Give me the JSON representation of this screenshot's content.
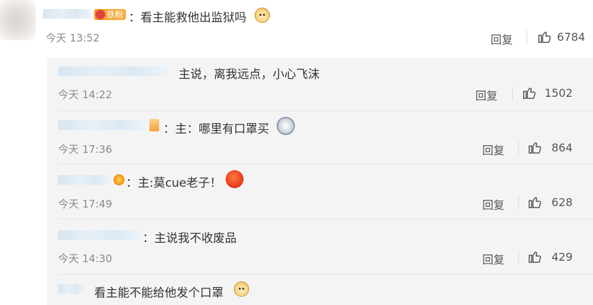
{
  "colors": {
    "text": "#333333",
    "meta": "#8a8a8a",
    "reply_bg": "#f4f4f4",
    "badge": "#f5a030"
  },
  "top_comment": {
    "badge_label": "铁粉",
    "text": "：看主能救他出监狱吗",
    "emoji": "doge-emoji",
    "time": "今天 13:52",
    "reply_label": "回复",
    "like_icon": "thumbs-up-icon",
    "like_count": "6784"
  },
  "replies": [
    {
      "text": "主说，离我远点，小心飞沫",
      "time": "今天 14:22",
      "reply_label": "回复",
      "like_count": "1502"
    },
    {
      "text": "：主：哪里有口罩买",
      "time": "今天 17:36",
      "reply_label": "回复",
      "like_count": "864",
      "emoji": "husky-emoji"
    },
    {
      "text": "：主:莫cue老子！",
      "time": "今天 17:49",
      "reply_label": "回复",
      "like_count": "628",
      "emoji": "angry-emoji"
    },
    {
      "text": "：主说我不收废品",
      "time": "今天 14:30",
      "reply_label": "回复",
      "like_count": "429"
    },
    {
      "text": "看主能不能给他发个口罩",
      "emoji": "doge-emoji"
    }
  ]
}
